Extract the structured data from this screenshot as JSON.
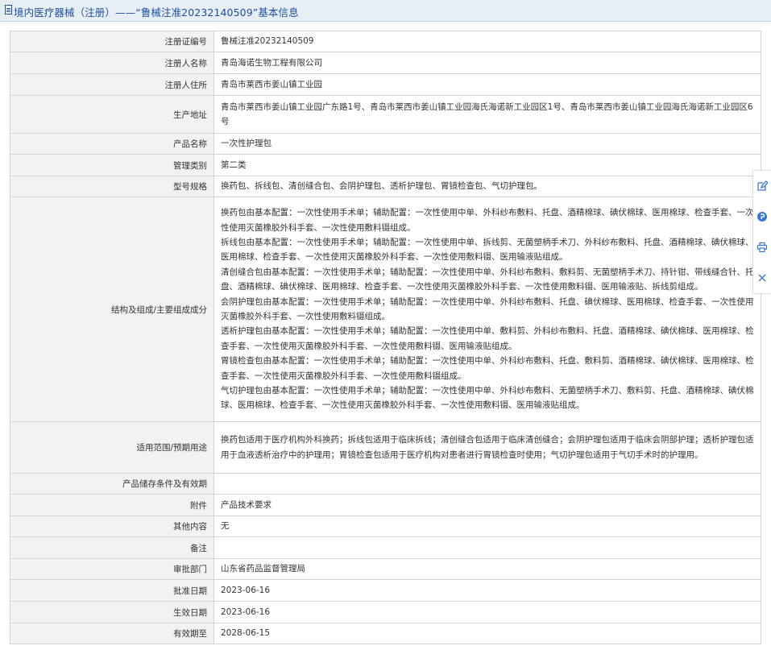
{
  "header": {
    "title": "境内医疗器械（注册）——“鲁械注准20232140509”基本信息"
  },
  "rows": [
    {
      "label": "注册证编号",
      "value": "鲁械注准20232140509"
    },
    {
      "label": "注册人名称",
      "value": "青岛海诺生物工程有限公司"
    },
    {
      "label": "注册人住所",
      "value": "青岛市莱西市姜山镇工业园"
    },
    {
      "label": "生产地址",
      "value": "青岛市莱西市姜山镇工业园广东路1号、青岛市莱西市姜山镇工业园海氏海诺新工业园区1号、青岛市莱西市姜山镇工业园海氏海诺新工业园区6号"
    },
    {
      "label": "产品名称",
      "value": "一次性护理包"
    },
    {
      "label": "管理类别",
      "value": "第二类"
    },
    {
      "label": "型号规格",
      "value": "换药包、拆线包、清创缝合包、会阴护理包、透析护理包、胃镜检查包、气切护理包。"
    },
    {
      "label": "结构及组成/主要组成成分",
      "paragraphs": [
        "换药包由基本配置：一次性使用手术单；辅助配置：一次性使用中单、外科纱布敷料、托盘、酒精棉球、碘伏棉球、医用棉球、检查手套、一次性使用灭菌橡胶外科手套、一次性使用敷料镊组成。",
        "拆线包由基本配置：一次性使用手术单；辅助配置：一次性使用中单、拆线剪、无菌塑柄手术刀、外科纱布敷料、托盘、酒精棉球、碘伏棉球、医用棉球、检查手套、一次性使用灭菌橡胶外科手套、一次性使用敷料镊、医用输液贴组成。",
        "清创缝合包由基本配置：一次性使用手术单；辅助配置：一次性使用中单、外科纱布敷料、敷料剪、无菌塑柄手术刀、持针钳、带线缝合针、托盘、酒精棉球、碘伏棉球、医用棉球、检查手套、一次性使用灭菌橡胶外科手套、一次性使用敷料镊、医用输液贴、拆线剪组成。",
        "会阴护理包由基本配置：一次性使用手术单；辅助配置：一次性使用中单、外科纱布敷料、托盘、碘伏棉球、医用棉球、检查手套、一次性使用灭菌橡胶外科手套、一次性使用敷料镊组成。",
        "透析护理包由基本配置：一次性使用手术单；辅助配置：一次性使用中单、敷料剪、外科纱布敷料、托盘、酒精棉球、碘伏棉球、医用棉球、检查手套、一次性使用灭菌橡胶外科手套、一次性使用敷料镊、医用输液贴组成。",
        "胃镜检查包由基本配置：一次性使用手术单；辅助配置：一次性使用中单、外科纱布敷料、托盘、敷料剪、酒精棉球、碘伏棉球、医用棉球、检查手套、一次性使用灭菌橡胶外科手套、一次性使用敷料镊组成。",
        "气切护理包由基本配置：一次性使用手术单；辅助配置：一次性使用中单、外科纱布敷料、无菌塑柄手术刀、敷料剪、托盘、酒精棉球、碘伏棉球、医用棉球、检查手套、一次性使用灭菌橡胶外科手套、一次性使用敷料镊、医用输液贴组成。"
      ]
    },
    {
      "label": "适用范围/预期用途",
      "value": "换药包适用于医疗机构外科换药；拆线包适用于临床拆线；清创缝合包适用于临床清创缝合；会阴护理包适用于临床会阴部护理；透析护理包适用于血液透析治疗中的护理用；胃镜检查包适用于医疗机构对患者进行胃镜检查时使用；气切护理包适用于气切手术时的护理用。"
    },
    {
      "label": "产品储存条件及有效期",
      "value": ""
    },
    {
      "label": "附件",
      "value": "产品技术要求"
    },
    {
      "label": "其他内容",
      "value": "无"
    },
    {
      "label": "备注",
      "value": ""
    },
    {
      "label": "审批部门",
      "value": "山东省药品监督管理局"
    },
    {
      "label": "批准日期",
      "value": "2023-06-16"
    },
    {
      "label": "生效日期",
      "value": "2023-06-16"
    },
    {
      "label": "有效期至",
      "value": "2028-06-15"
    }
  ],
  "toolbar": {
    "icons": [
      "edit-icon",
      "feedback-icon",
      "print-icon",
      "close-icon"
    ]
  },
  "colors": {
    "header_bg": "#e8eef6",
    "header_text": "#1b4f9c",
    "label_bg": "#f2f2f2",
    "border": "#d4d4d4",
    "toolbar_icon": "#3b78c9"
  }
}
